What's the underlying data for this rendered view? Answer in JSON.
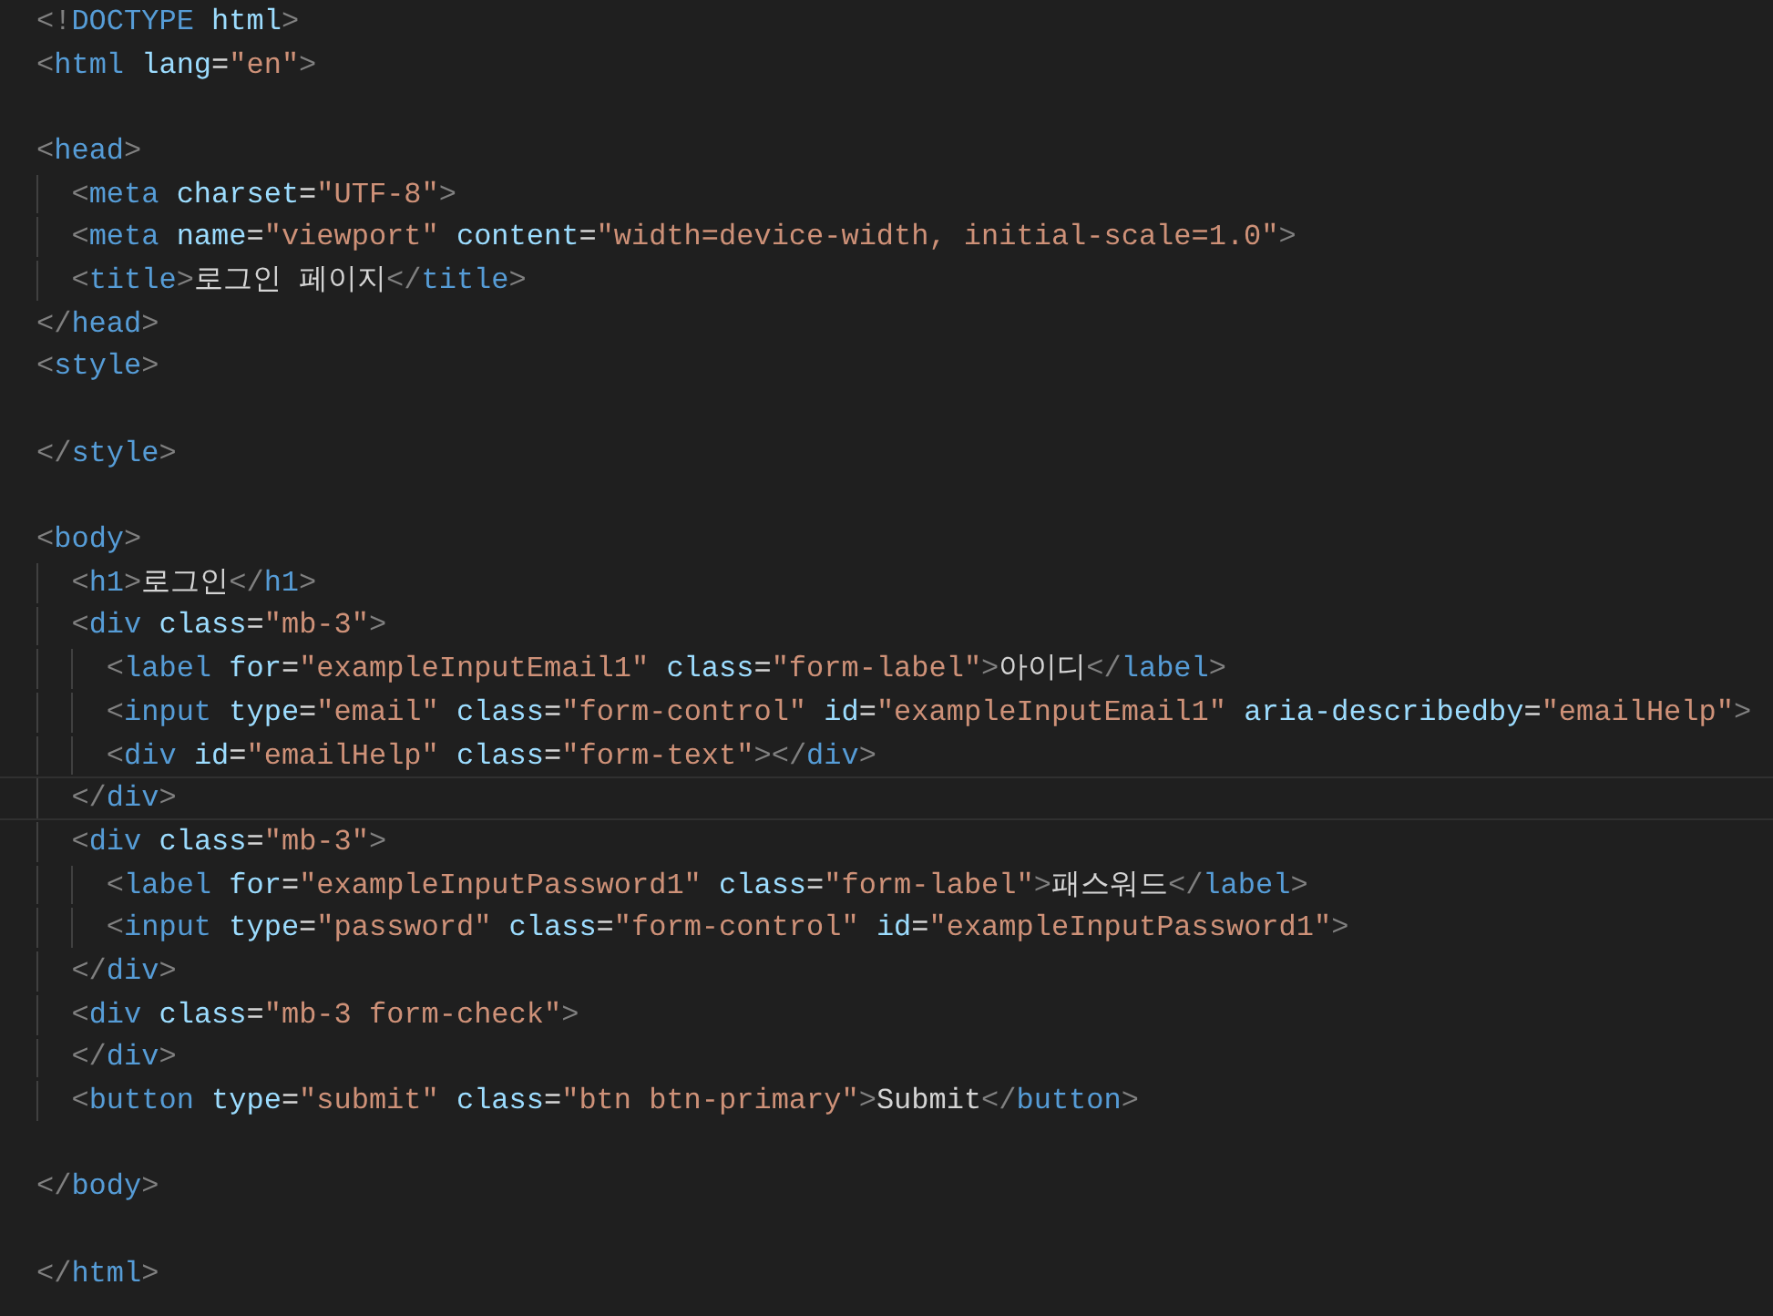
{
  "editor": {
    "lines": [
      {
        "current": false,
        "text": "<!DOCTYPE html>"
      },
      {
        "current": false,
        "text": "<html lang=\"en\">"
      },
      {
        "current": false
      },
      {
        "current": false,
        "text": "<head>"
      },
      {
        "current": false,
        "text": "  <meta charset=\"UTF-8\">"
      },
      {
        "current": false,
        "text": "  <meta name=\"viewport\" content=\"width=device-width, initial-scale=1.0\">"
      },
      {
        "current": false,
        "text": "  <title>로그인 페이지</title>"
      },
      {
        "current": false,
        "text": "</head>"
      },
      {
        "current": false,
        "text": "<style>"
      },
      {
        "current": false
      },
      {
        "current": false,
        "text": "</style>"
      },
      {
        "current": false
      },
      {
        "current": false,
        "text": "<body>"
      },
      {
        "current": false,
        "text": "  <h1>로그인</h1>"
      },
      {
        "current": false,
        "text": "  <div class=\"mb-3\">"
      },
      {
        "current": false,
        "text": "    <label for=\"exampleInputEmail1\" class=\"form-label\">아이디</label>"
      },
      {
        "current": false,
        "text": "    <input type=\"email\" class=\"form-control\" id=\"exampleInputEmail1\" aria-describedby=\"emailHelp\">"
      },
      {
        "current": false,
        "text": "    <div id=\"emailHelp\" class=\"form-text\"></div>"
      },
      {
        "current": true,
        "text": "  </div>"
      },
      {
        "current": false,
        "text": "  <div class=\"mb-3\">"
      },
      {
        "current": false,
        "text": "    <label for=\"exampleInputPassword1\" class=\"form-label\">패스워드</label>"
      },
      {
        "current": false,
        "text": "    <input type=\"password\" class=\"form-control\" id=\"exampleInputPassword1\">"
      },
      {
        "current": false,
        "text": "  </div>"
      },
      {
        "current": false,
        "text": "  <div class=\"mb-3 form-check\">"
      },
      {
        "current": false,
        "text": "  </div>"
      },
      {
        "current": false,
        "text": "  <button type=\"submit\" class=\"btn btn-primary\">Submit</button>"
      },
      {
        "current": false
      },
      {
        "current": false,
        "text": "</body>"
      },
      {
        "current": false
      },
      {
        "current": false,
        "text": "</html>"
      }
    ]
  }
}
